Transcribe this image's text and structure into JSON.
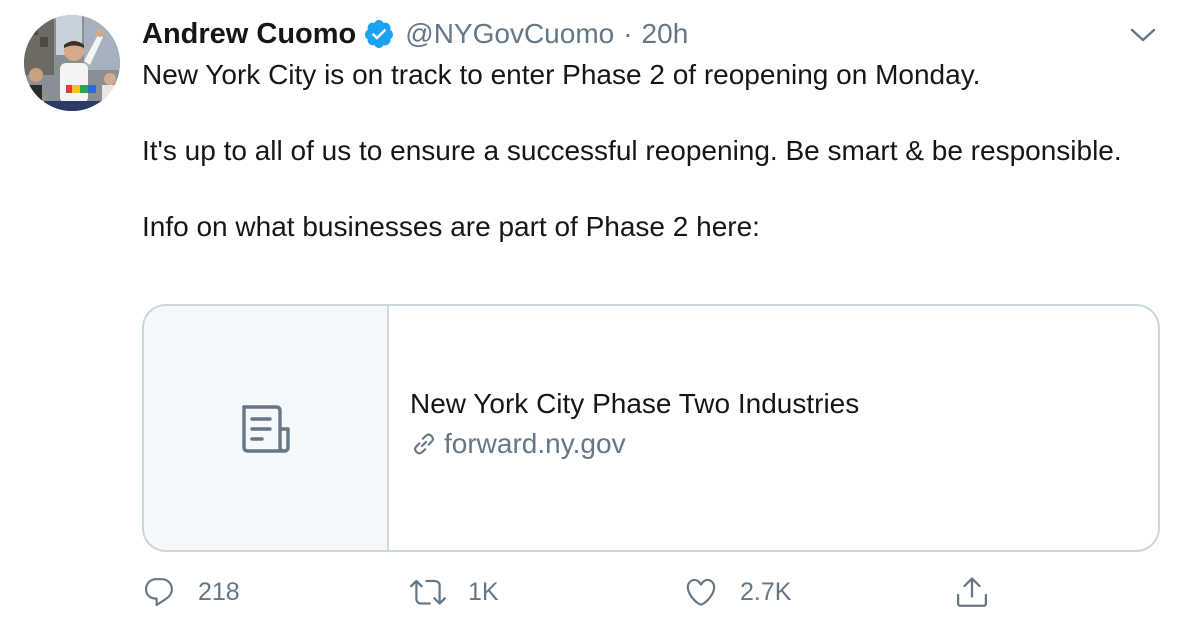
{
  "author": {
    "display_name": "Andrew Cuomo",
    "handle": "@NYGovCuomo",
    "separator": "·",
    "time": "20h",
    "verified": true,
    "avatar": "profile-photo"
  },
  "tweet": {
    "paragraphs": [
      "New York City is on track to enter Phase 2 of reopening on Monday.",
      "It's up to all of us to ensure a successful reopening. Be smart & be responsible.",
      "Info on what businesses are part of Phase 2 here:"
    ]
  },
  "card": {
    "icon": "document-icon",
    "title": "New York City Phase Two Industries",
    "domain": "forward.ny.gov",
    "link_icon": "link-icon"
  },
  "actions": {
    "reply": {
      "icon": "reply-icon",
      "count": "218"
    },
    "retweet": {
      "icon": "retweet-icon",
      "count": "1K"
    },
    "like": {
      "icon": "heart-icon",
      "count": "2.7K"
    },
    "share": {
      "icon": "share-icon"
    }
  },
  "menu": {
    "icon": "chevron-down-icon"
  },
  "colors": {
    "text_primary": "#14171a",
    "text_secondary": "#657786",
    "verified_blue": "#1da1f2",
    "card_border": "#ccd6dd",
    "card_media_bg": "#f5f8fa"
  }
}
